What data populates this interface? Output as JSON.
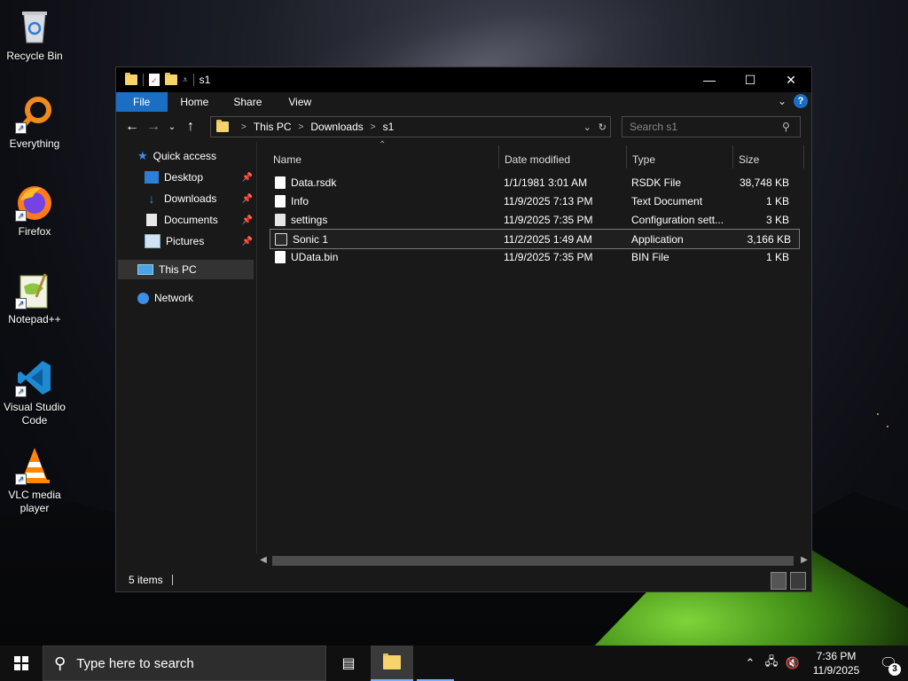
{
  "desktop": {
    "icons": [
      {
        "label": "Recycle Bin"
      },
      {
        "label": "Everything"
      },
      {
        "label": "Firefox"
      },
      {
        "label": "Notepad++"
      },
      {
        "label": "Visual Studio Code"
      },
      {
        "label": "VLC media player"
      }
    ]
  },
  "explorer": {
    "title": "s1",
    "ribbon": {
      "file": "File",
      "home": "Home",
      "share": "Share",
      "view": "View"
    },
    "address": {
      "crumbs": [
        "This PC",
        "Downloads",
        "s1"
      ]
    },
    "search": {
      "placeholder": "Search s1"
    },
    "nav": {
      "quick_access": "Quick access",
      "desktop": "Desktop",
      "downloads": "Downloads",
      "documents": "Documents",
      "pictures": "Pictures",
      "this_pc": "This PC",
      "network": "Network"
    },
    "columns": {
      "name": "Name",
      "date": "Date modified",
      "type": "Type",
      "size": "Size"
    },
    "files": [
      {
        "name": "Data.rsdk",
        "date": "1/1/1981 3:01 AM",
        "type": "RSDK File",
        "size": "38,748 KB"
      },
      {
        "name": "Info",
        "date": "11/9/2025 7:13 PM",
        "type": "Text Document",
        "size": "1 KB"
      },
      {
        "name": "settings",
        "date": "11/9/2025 7:35 PM",
        "type": "Configuration sett...",
        "size": "3 KB"
      },
      {
        "name": "Sonic 1",
        "date": "11/2/2025 1:49 AM",
        "type": "Application",
        "size": "3,166 KB"
      },
      {
        "name": "UData.bin",
        "date": "11/9/2025 7:35 PM",
        "type": "BIN File",
        "size": "1 KB"
      }
    ],
    "status": {
      "items": "5 items"
    }
  },
  "taskbar": {
    "search_placeholder": "Type here to search",
    "clock_time": "7:36 PM",
    "clock_date": "11/9/2025",
    "notification_count": "3"
  }
}
